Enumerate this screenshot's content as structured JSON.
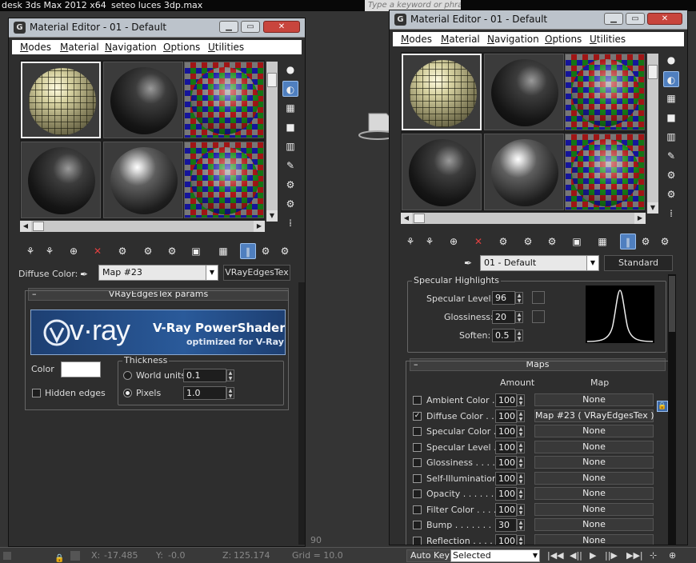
{
  "app": {
    "title_fragment": "desk 3ds Max  2012 x64",
    "file_title": "seteo luces 3dp.max",
    "search_placeholder": "Type a keyword or phrase"
  },
  "editor_left": {
    "title": "Material Editor - 01 - Default",
    "menu": [
      "Modes",
      "Material",
      "Navigation",
      "Options",
      "Utilities"
    ],
    "diffuse_label": "Diffuse Color:",
    "map_name": "Map #23",
    "map_type": "VRayEdgesTex",
    "rollout_title": "VRayEdgesTex params",
    "banner": {
      "logo": "v·ray",
      "product": "V-Ray PowerShader",
      "tagline": "optimized for V-Ray"
    },
    "color_label": "Color",
    "thickness_label": "Thickness",
    "world_units_label": "World units",
    "world_units_value": "0.1",
    "pixels_label": "Pixels",
    "pixels_value": "1.0",
    "hidden_edges_label": "Hidden edges",
    "thickness_mode": "Pixels",
    "hidden_edges_checked": false
  },
  "editor_right": {
    "title": "Material Editor - 01 - Default",
    "menu": [
      "Modes",
      "Material",
      "Navigation",
      "Options",
      "Utilities"
    ],
    "material_name": "01 - Default",
    "material_type": "Standard",
    "specular": {
      "group_title": "Specular Highlights",
      "level_label": "Specular Level:",
      "level_value": "96",
      "gloss_label": "Glossiness:",
      "gloss_value": "20",
      "soften_label": "Soften:",
      "soften_value": "0.5"
    },
    "maps": {
      "title": "Maps",
      "col_amount": "Amount",
      "col_map": "Map",
      "rows": [
        {
          "label": "Ambient Color . .",
          "amount": "100",
          "map": "None",
          "checked": false
        },
        {
          "label": "Diffuse Color . . .",
          "amount": "100",
          "map": "Map #23  ( VRayEdgesTex )",
          "checked": true
        },
        {
          "label": "Specular Color  .",
          "amount": "100",
          "map": "None",
          "checked": false
        },
        {
          "label": "Specular Level  .",
          "amount": "100",
          "map": "None",
          "checked": false
        },
        {
          "label": "Glossiness  . . . .",
          "amount": "100",
          "map": "None",
          "checked": false
        },
        {
          "label": "Self-Illumination .",
          "amount": "100",
          "map": "None",
          "checked": false
        },
        {
          "label": "Opacity . . . . . .",
          "amount": "100",
          "map": "None",
          "checked": false
        },
        {
          "label": "Filter Color  . . . .",
          "amount": "100",
          "map": "None",
          "checked": false
        },
        {
          "label": "Bump  . . . . . . .",
          "amount": "30",
          "map": "None",
          "checked": false
        },
        {
          "label": "Reflection  . . . .",
          "amount": "100",
          "map": "None",
          "checked": false
        }
      ]
    }
  },
  "statusbar": {
    "x_label": "X:",
    "x_value": "-17.485",
    "y_label": "Y:",
    "y_value": "-0.0",
    "z_label": "Z:",
    "z_value": "125.174",
    "grid": "Grid = 10.0",
    "ruler_mark": "90",
    "autokey": "Auto Key",
    "selected": "Selected"
  },
  "colors": {
    "accent_blue": "#4f7fbf",
    "titlebar": "#bcc3cb",
    "close_red": "#c8453d",
    "vray_blue": "#1d3f72"
  }
}
